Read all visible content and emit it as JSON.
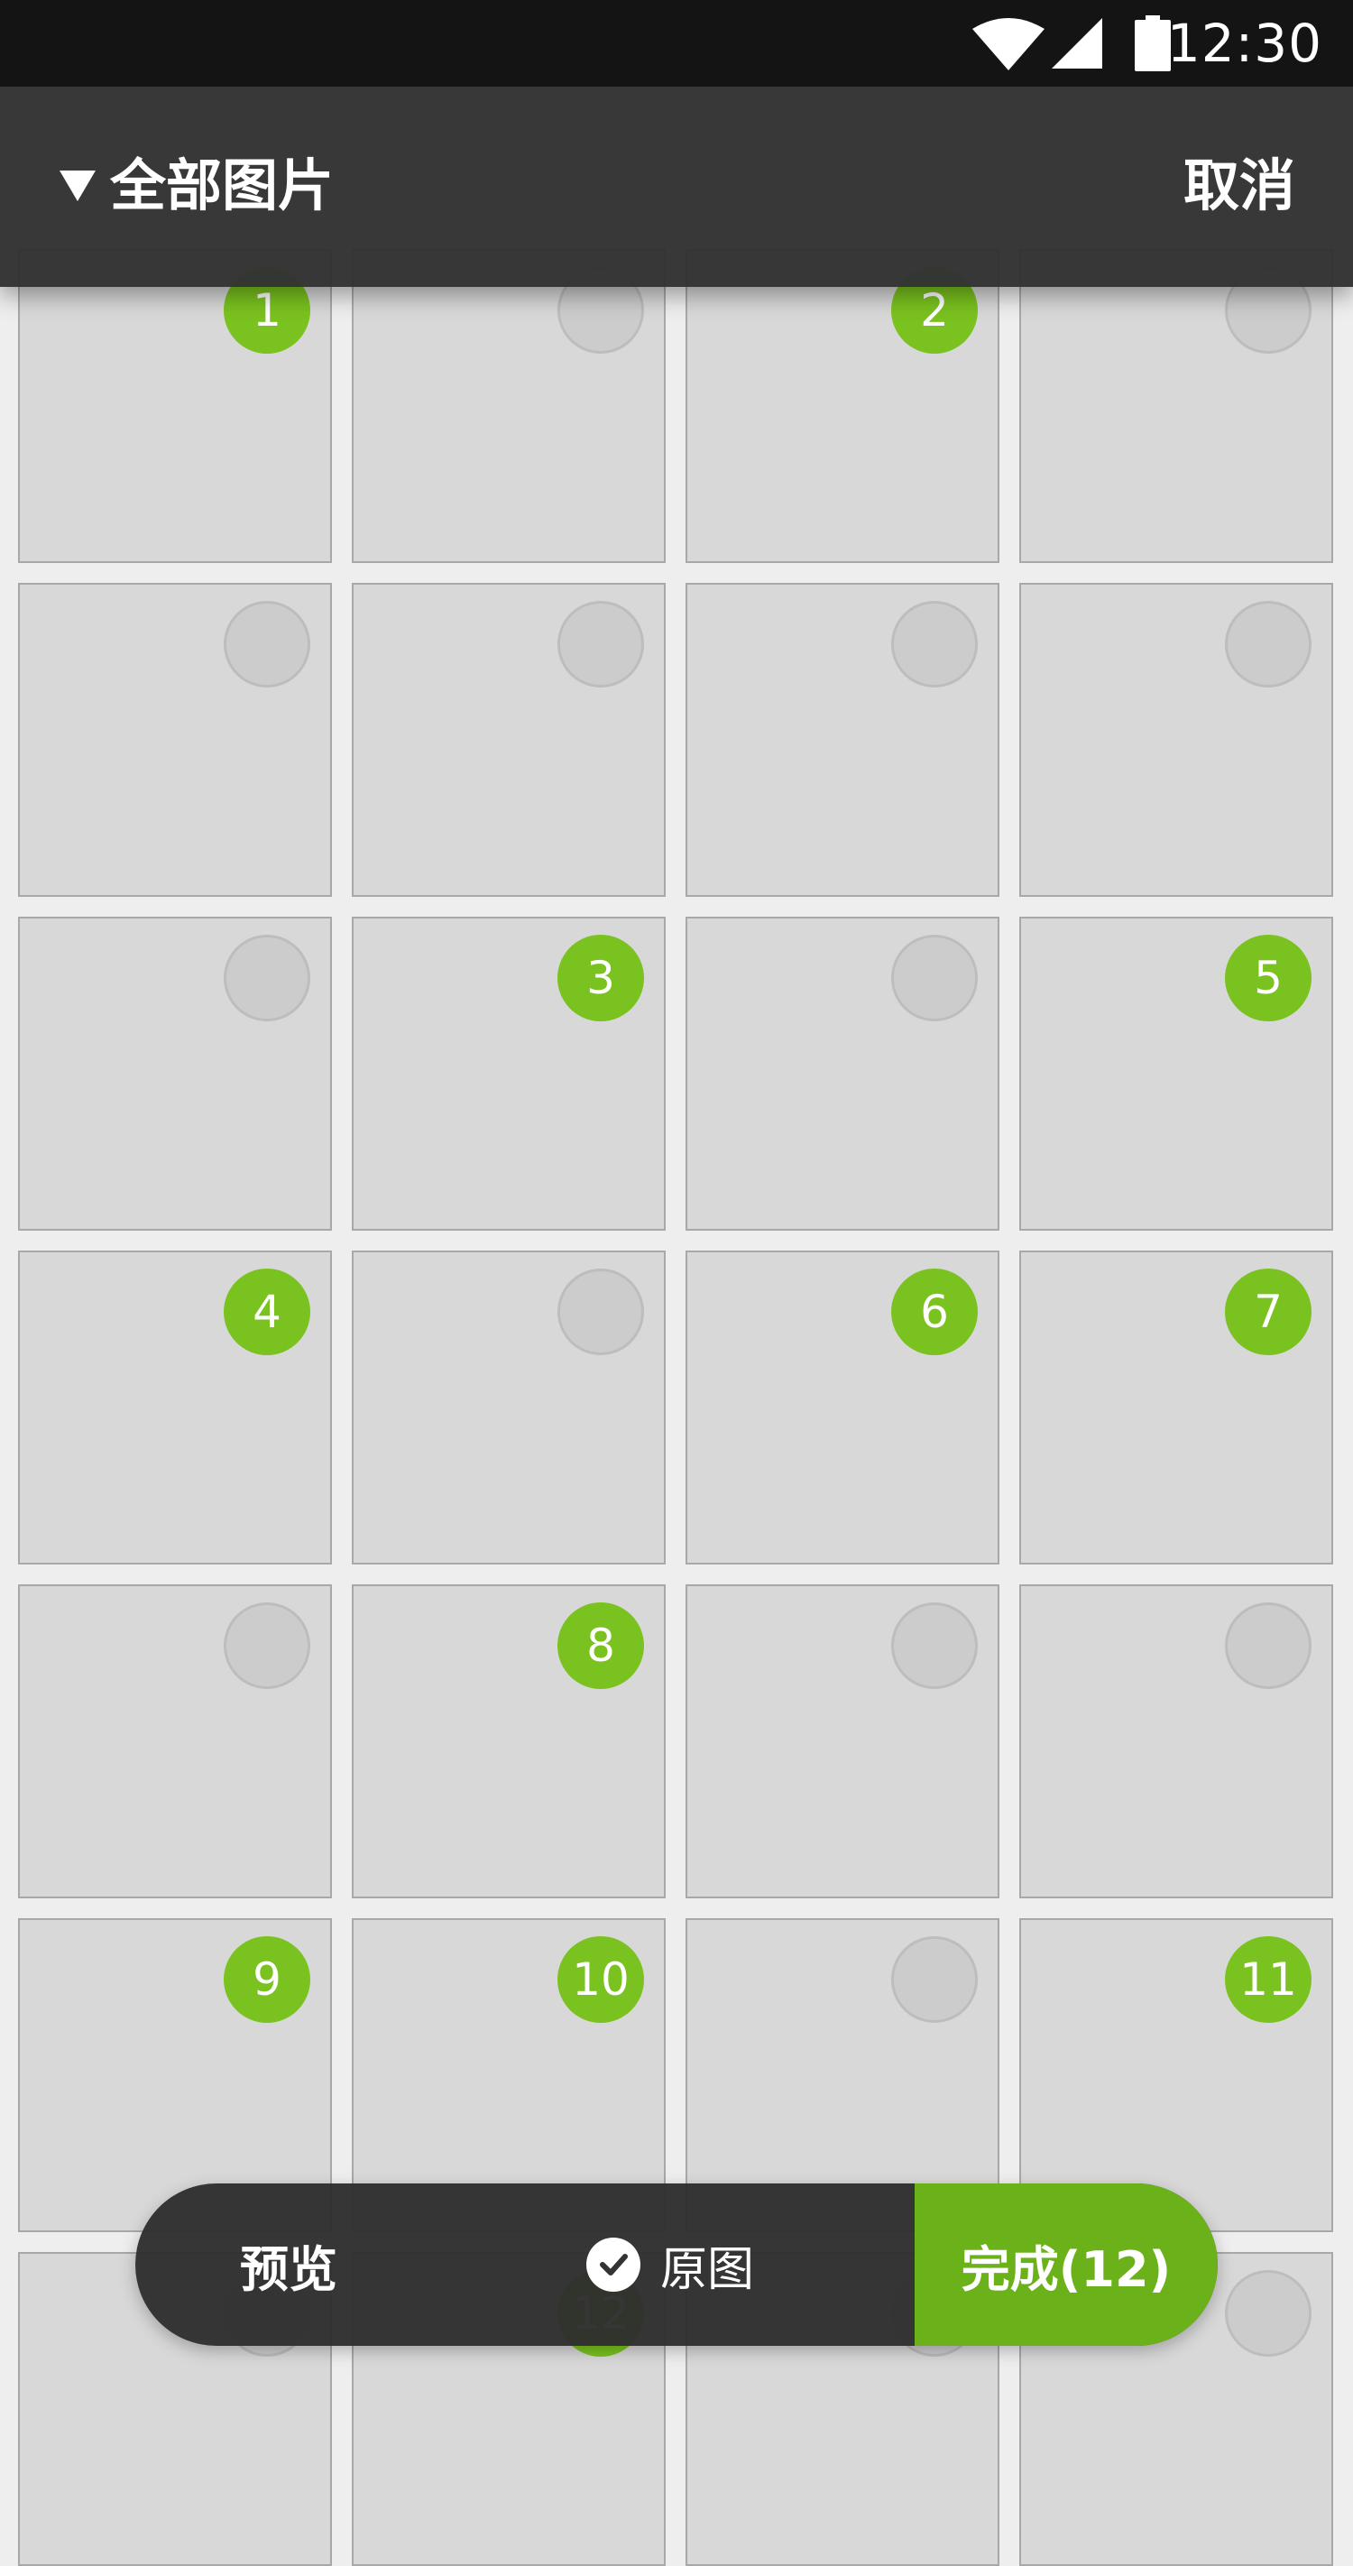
{
  "status_bar": {
    "time": "12:30",
    "icons": [
      "wifi-icon",
      "cellular-signal-icon",
      "battery-icon"
    ]
  },
  "header": {
    "album_title": "全部图片",
    "cancel_label": "取消",
    "dropdown_icon": "triangle-down-icon"
  },
  "grid": {
    "columns": 4,
    "selection_order": [
      1,
      null,
      2,
      null,
      null,
      null,
      null,
      null,
      null,
      3,
      null,
      5,
      4,
      null,
      6,
      7,
      null,
      8,
      null,
      null,
      9,
      10,
      null,
      11,
      null,
      12,
      null,
      null
    ]
  },
  "bottom_bar": {
    "preview_label": "预览",
    "original_label": "原图",
    "done_label": "完成(12)"
  },
  "colors": {
    "accent": "#7ac21f",
    "accent_dark": "#6bb11a",
    "bar_dark": "#323232"
  }
}
